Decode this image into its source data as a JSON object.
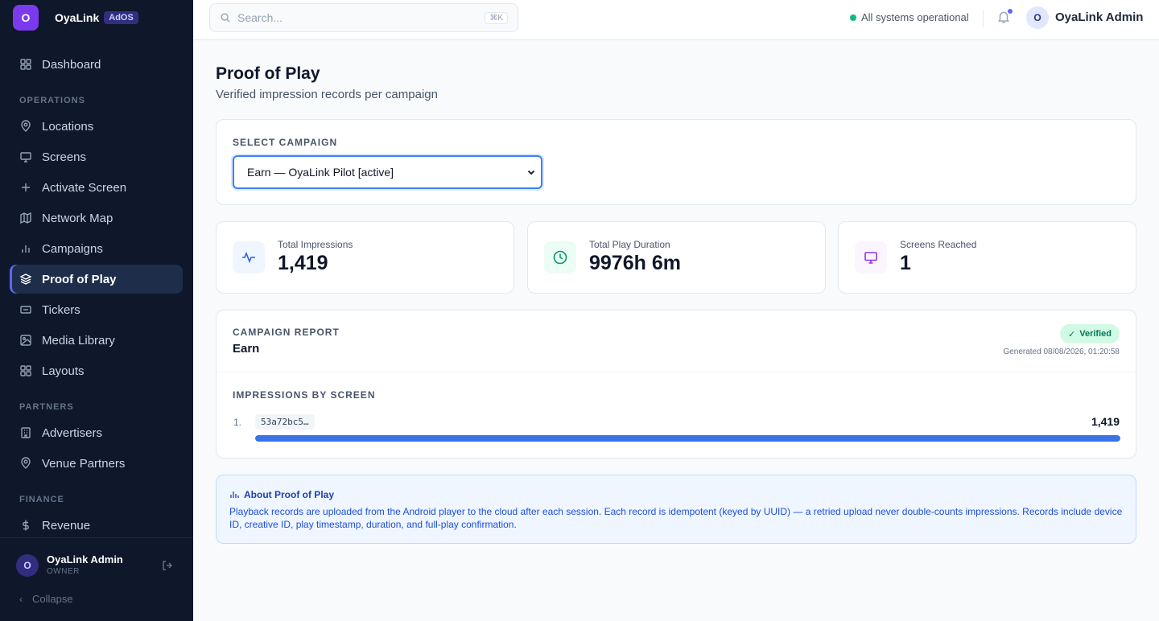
{
  "brand": {
    "logo_letter": "O",
    "name": "OyaLink",
    "badge": "AdOS"
  },
  "sidebar": {
    "items": [
      {
        "label": "Dashboard",
        "icon": "grid-icon"
      },
      {
        "label": "Locations",
        "icon": "map-pin-icon"
      },
      {
        "label": "Screens",
        "icon": "monitor-icon"
      },
      {
        "label": "Activate Screen",
        "icon": "plus-icon"
      },
      {
        "label": "Network Map",
        "icon": "map-icon"
      },
      {
        "label": "Campaigns",
        "icon": "bar-chart-icon"
      },
      {
        "label": "Proof of Play",
        "icon": "layers-icon",
        "active": true
      },
      {
        "label": "Tickers",
        "icon": "ticker-icon"
      },
      {
        "label": "Media Library",
        "icon": "image-icon"
      },
      {
        "label": "Layouts",
        "icon": "layout-icon"
      },
      {
        "label": "Advertisers",
        "icon": "building-icon"
      },
      {
        "label": "Venue Partners",
        "icon": "map-pin-icon"
      },
      {
        "label": "Revenue",
        "icon": "dollar-icon"
      }
    ],
    "sections": {
      "operations": "OPERATIONS",
      "partners": "PARTNERS",
      "finance": "FINANCE"
    },
    "footer": {
      "avatar": "O",
      "name": "OyaLink Admin",
      "role": "OWNER",
      "collapse": "Collapse"
    }
  },
  "topbar": {
    "search_placeholder": "Search...",
    "search_shortcut": "⌘K",
    "status": "All systems operational",
    "avatar": "O",
    "user": "OyaLink Admin"
  },
  "page": {
    "title": "Proof of Play",
    "subtitle": "Verified impression records per campaign"
  },
  "campaign_select": {
    "label": "SELECT CAMPAIGN",
    "value": "Earn — OyaLink Pilot [active]"
  },
  "stats": [
    {
      "label": "Total Impressions",
      "value": "1,419",
      "icon": "activity-icon",
      "color": "#2563eb",
      "bg": "#eff6ff"
    },
    {
      "label": "Total Play Duration",
      "value": "9976h 6m",
      "icon": "clock-icon",
      "color": "#059669",
      "bg": "#ecfdf5"
    },
    {
      "label": "Screens Reached",
      "value": "1",
      "icon": "monitor-icon",
      "color": "#9333ea",
      "bg": "#faf5ff"
    }
  ],
  "report": {
    "label": "CAMPAIGN REPORT",
    "name": "Earn",
    "verified": "Verified",
    "generated": "Generated 08/08/2026, 01:20:58",
    "impressions_label": "IMPRESSIONS BY SCREEN",
    "rows": [
      {
        "rank": "1.",
        "screen": "53a72bc5…",
        "value": "1,419",
        "share": 1.0
      }
    ]
  },
  "info": {
    "title": "About Proof of Play",
    "text": "Playback records are uploaded from the Android player to the cloud after each session. Each record is idempotent (keyed by UUID) — a retried upload never double-counts impressions. Records include device ID, creative ID, play timestamp, duration, and full-play confirmation."
  }
}
